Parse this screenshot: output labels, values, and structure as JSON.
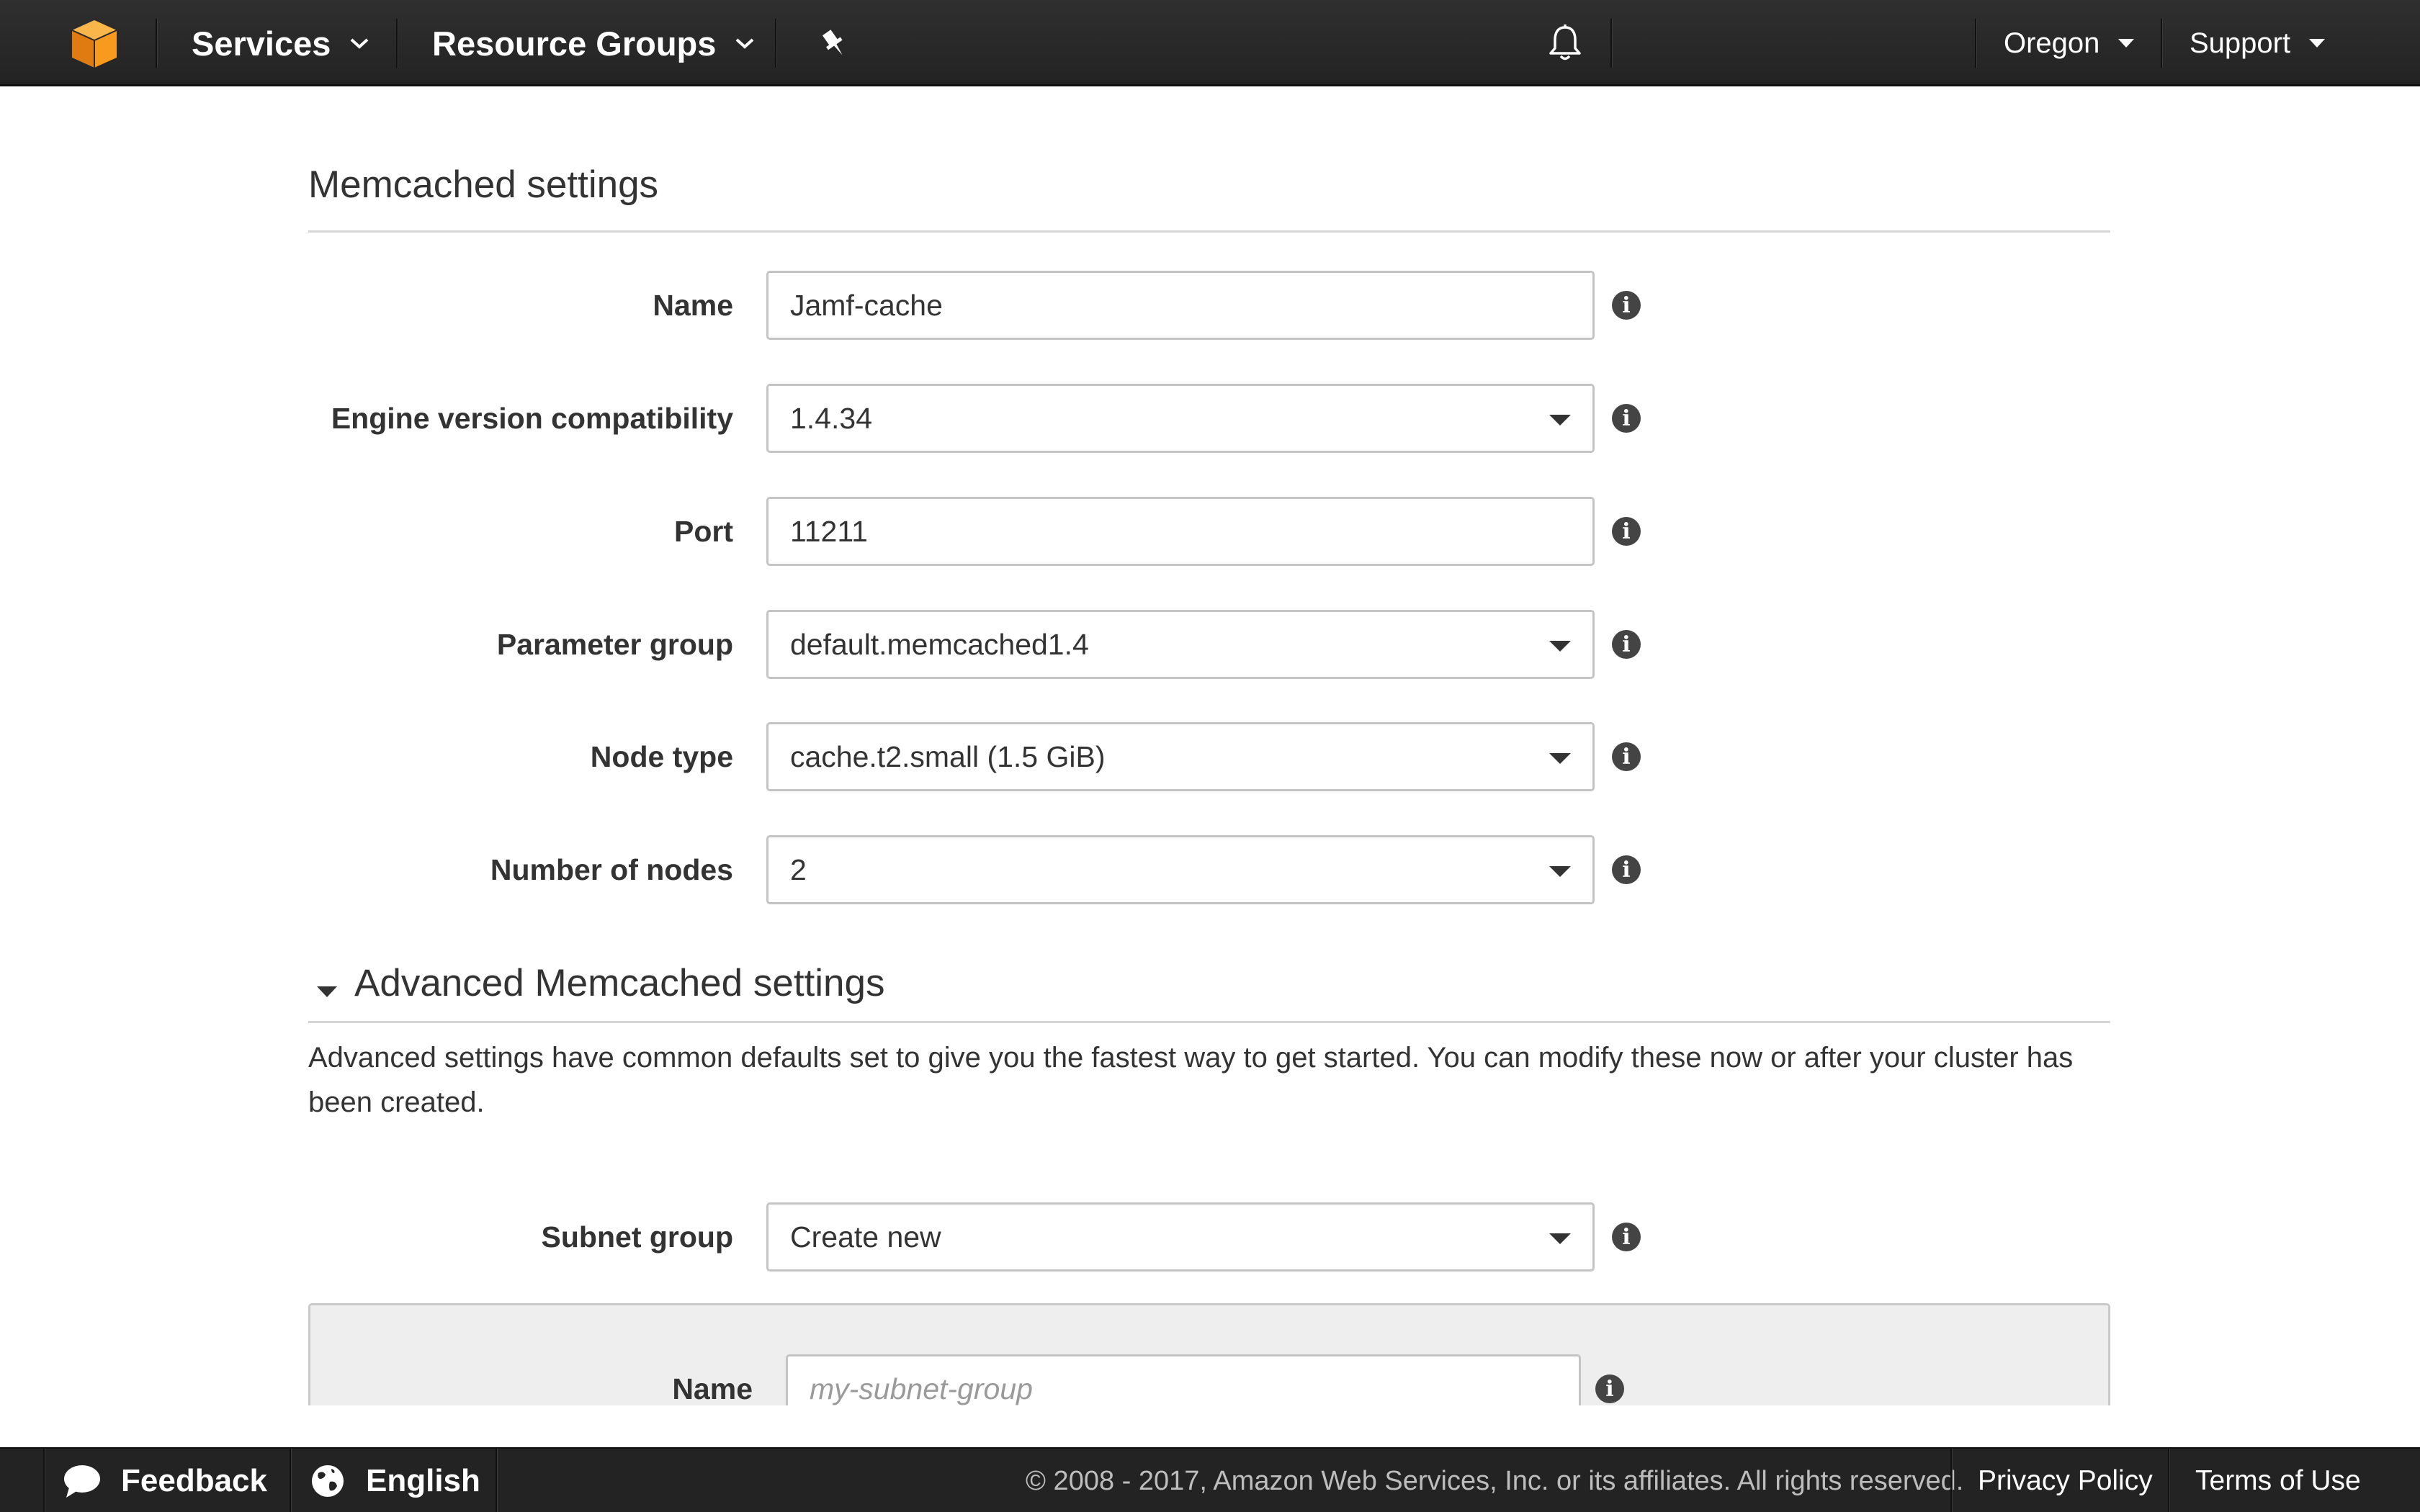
{
  "colors": {
    "nav_bg": "#232323",
    "accent_orange": "#f79a1d",
    "text": "#333333"
  },
  "nav": {
    "logo_icon": "aws-cube-icon",
    "services_label": "Services",
    "resource_groups_label": "Resource Groups",
    "pin_icon": "pin-icon",
    "bell_icon": "bell-icon",
    "region_label": "Oregon",
    "support_label": "Support"
  },
  "memcached": {
    "title": "Memcached settings",
    "fields": {
      "name": {
        "label": "Name",
        "value": "Jamf-cache"
      },
      "engine": {
        "label": "Engine version compatibility",
        "value": "1.4.34"
      },
      "port": {
        "label": "Port",
        "value": "11211"
      },
      "parameter_group": {
        "label": "Parameter group",
        "value": "default.memcached1.4"
      },
      "node_type": {
        "label": "Node type",
        "value": "cache.t2.small (1.5 GiB)"
      },
      "nodes": {
        "label": "Number of nodes",
        "value": "2"
      }
    }
  },
  "advanced": {
    "title": "Advanced Memcached settings",
    "description": "Advanced settings have common defaults set to give you the fastest way to get started. You can modify these now or after your cluster has been created.",
    "subnet_group": {
      "label": "Subnet group",
      "value": "Create new"
    },
    "subnet_name": {
      "label": "Name",
      "placeholder": "my-subnet-group",
      "value": ""
    }
  },
  "footer": {
    "feedback_label": "Feedback",
    "language_label": "English",
    "copyright": "© 2008 - 2017, Amazon Web Services, Inc. or its affiliates. All rights reserved.",
    "privacy_label": "Privacy Policy",
    "terms_label": "Terms of Use"
  }
}
